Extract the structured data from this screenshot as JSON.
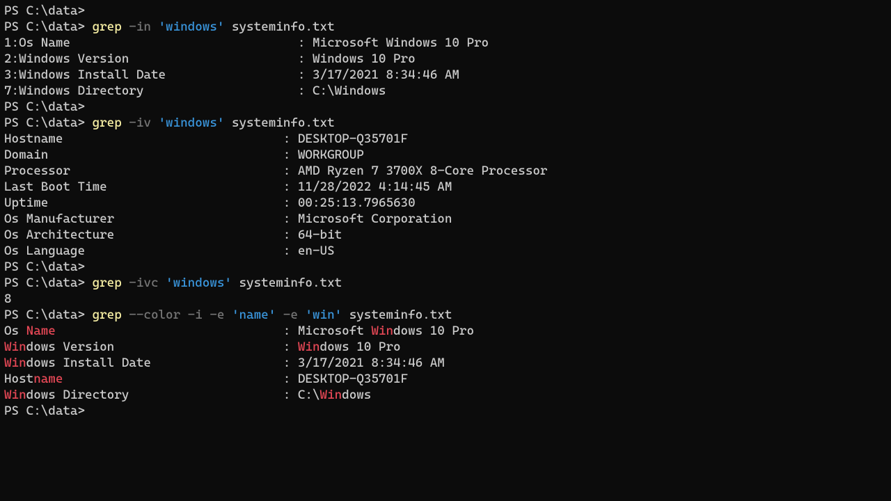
{
  "prompt": "PS C:\\data>",
  "blocks": [
    {
      "type": "prompt_only"
    },
    {
      "type": "command",
      "parts": [
        {
          "cls": "cmd",
          "t": "grep"
        },
        {
          "cls": "sp",
          "t": " "
        },
        {
          "cls": "flag",
          "t": "-in"
        },
        {
          "cls": "sp",
          "t": " "
        },
        {
          "cls": "str",
          "t": "'windows'"
        },
        {
          "cls": "sp",
          "t": " "
        },
        {
          "cls": "argfile",
          "t": "systeminfo.txt"
        }
      ],
      "output": [
        "1:Os Name                               : Microsoft Windows 10 Pro",
        "2:Windows Version                       : Windows 10 Pro",
        "3:Windows Install Date                  : 3/17/2021 8:34:46 AM",
        "7:Windows Directory                     : C:\\Windows"
      ]
    },
    {
      "type": "prompt_only"
    },
    {
      "type": "command",
      "parts": [
        {
          "cls": "cmd",
          "t": "grep"
        },
        {
          "cls": "sp",
          "t": " "
        },
        {
          "cls": "flag",
          "t": "-iv"
        },
        {
          "cls": "sp",
          "t": " "
        },
        {
          "cls": "str",
          "t": "'windows'"
        },
        {
          "cls": "sp",
          "t": " "
        },
        {
          "cls": "argfile",
          "t": "systeminfo.txt"
        }
      ],
      "output": [
        "Hostname                              : DESKTOP-Q35701F",
        "Domain                                : WORKGROUP",
        "Processor                             : AMD Ryzen 7 3700X 8-Core Processor",
        "Last Boot Time                        : 11/28/2022 4:14:45 AM",
        "Uptime                                : 00:25:13.7965630",
        "Os Manufacturer                       : Microsoft Corporation",
        "Os Architecture                       : 64-bit",
        "Os Language                           : en-US"
      ]
    },
    {
      "type": "prompt_only"
    },
    {
      "type": "command",
      "parts": [
        {
          "cls": "cmd",
          "t": "grep"
        },
        {
          "cls": "sp",
          "t": " "
        },
        {
          "cls": "flag",
          "t": "-ivc"
        },
        {
          "cls": "sp",
          "t": " "
        },
        {
          "cls": "str",
          "t": "'windows'"
        },
        {
          "cls": "sp",
          "t": " "
        },
        {
          "cls": "argfile",
          "t": "systeminfo.txt"
        }
      ],
      "output": [
        "8"
      ]
    },
    {
      "type": "command",
      "parts": [
        {
          "cls": "cmd",
          "t": "grep"
        },
        {
          "cls": "sp",
          "t": " "
        },
        {
          "cls": "flag",
          "t": "--color"
        },
        {
          "cls": "sp",
          "t": " "
        },
        {
          "cls": "flag",
          "t": "-i"
        },
        {
          "cls": "sp",
          "t": " "
        },
        {
          "cls": "flag",
          "t": "-e"
        },
        {
          "cls": "sp",
          "t": " "
        },
        {
          "cls": "str",
          "t": "'name'"
        },
        {
          "cls": "sp",
          "t": " "
        },
        {
          "cls": "flag",
          "t": "-e"
        },
        {
          "cls": "sp",
          "t": " "
        },
        {
          "cls": "str",
          "t": "'win'"
        },
        {
          "cls": "sp",
          "t": " "
        },
        {
          "cls": "argfile",
          "t": "systeminfo.txt"
        }
      ],
      "output_hl": [
        [
          {
            "t": "Os "
          },
          {
            "t": "Name",
            "m": true
          },
          {
            "t": "                               : Microsoft "
          },
          {
            "t": "Win",
            "m": true
          },
          {
            "t": "dows 10 Pro"
          }
        ],
        [
          {
            "t": "Win",
            "m": true
          },
          {
            "t": "dows Version                       : "
          },
          {
            "t": "Win",
            "m": true
          },
          {
            "t": "dows 10 Pro"
          }
        ],
        [
          {
            "t": "Win",
            "m": true
          },
          {
            "t": "dows Install Date                  : 3/17/2021 8:34:46 AM"
          }
        ],
        [
          {
            "t": "Host"
          },
          {
            "t": "name",
            "m": true
          },
          {
            "t": "                              : DESKTOP-Q35701F"
          }
        ],
        [
          {
            "t": "Win",
            "m": true
          },
          {
            "t": "dows Directory                     : C:\\"
          },
          {
            "t": "Win",
            "m": true
          },
          {
            "t": "dows"
          }
        ]
      ]
    },
    {
      "type": "prompt_only"
    }
  ]
}
